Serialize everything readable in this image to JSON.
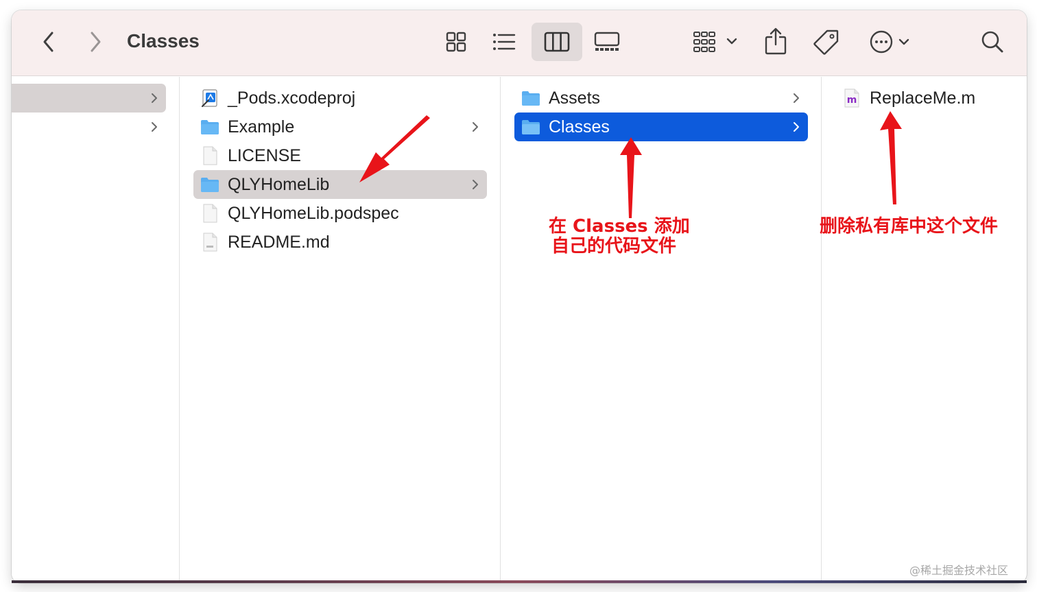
{
  "window": {
    "title": "Classes"
  },
  "toolbar": {
    "back_icon": "chevron-left-icon",
    "forward_icon": "chevron-right-icon",
    "views": [
      "icon-view-icon",
      "list-view-icon",
      "column-view-icon",
      "gallery-view-icon"
    ],
    "active_view": "column-view-icon",
    "group_icon": "group-grid-icon",
    "share_icon": "share-icon",
    "tag_icon": "tag-icon",
    "more_icon": "ellipsis-circle-icon",
    "search_icon": "search-icon"
  },
  "columns": {
    "sidebar": {
      "rows": 2
    },
    "project": {
      "items": [
        {
          "label": "_Pods.xcodeproj",
          "icon": "xcodeproj-icon",
          "has_children": false
        },
        {
          "label": "Example",
          "icon": "folder-icon",
          "has_children": true
        },
        {
          "label": "LICENSE",
          "icon": "document-icon",
          "has_children": false
        },
        {
          "label": "QLYHomeLib",
          "icon": "folder-icon",
          "has_children": true,
          "selected": "inactive"
        },
        {
          "label": "QLYHomeLib.podspec",
          "icon": "document-icon",
          "has_children": false
        },
        {
          "label": "README.md",
          "icon": "markdown-icon",
          "has_children": false
        }
      ]
    },
    "lib": {
      "items": [
        {
          "label": "Assets",
          "icon": "folder-icon",
          "has_children": true
        },
        {
          "label": "Classes",
          "icon": "folder-icon",
          "has_children": true,
          "selected": "active"
        }
      ]
    },
    "classes": {
      "items": [
        {
          "label": "ReplaceMe.m",
          "icon": "objc-source-icon",
          "badge": "m"
        }
      ]
    }
  },
  "annotations": {
    "classes_note_line1": "在 Classes 添加",
    "classes_note_line2": "自己的代码文件",
    "replace_note": "删除私有库中这个文件"
  },
  "watermark": "@稀土掘金技术社区",
  "colors": {
    "selection_blue": "#0d5bdc",
    "selection_gray": "#d7d2d2",
    "annotation_red": "#e8141a",
    "folder_blue": "#5aaef0",
    "toolbar_bg": "#f8eeee"
  }
}
